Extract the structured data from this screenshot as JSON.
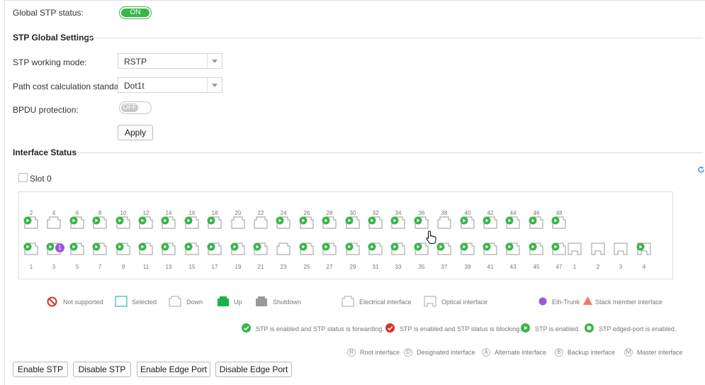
{
  "global": {
    "status_label": "Global STP status:",
    "status_toggle": "ON"
  },
  "settings": {
    "title": "STP Global Settings",
    "mode_label": "STP working mode:",
    "mode_value": "RSTP",
    "path_label": "Path cost calculation standard:",
    "path_value": "Dot1t",
    "bpdu_label": "BPDU protection:",
    "bpdu_toggle": "OFF",
    "apply": "Apply"
  },
  "interface": {
    "title": "Interface Status",
    "slot_label": "Slot 0",
    "top_ports": [
      {
        "n": "2",
        "state": "enabled"
      },
      {
        "n": "4",
        "state": "down"
      },
      {
        "n": "6",
        "state": "enabled"
      },
      {
        "n": "8",
        "state": "enabled"
      },
      {
        "n": "10",
        "state": "enabled"
      },
      {
        "n": "12",
        "state": "enabled"
      },
      {
        "n": "14",
        "state": "enabled"
      },
      {
        "n": "16",
        "state": "enabled"
      },
      {
        "n": "18",
        "state": "enabled"
      },
      {
        "n": "20",
        "state": "down"
      },
      {
        "n": "22",
        "state": "down"
      },
      {
        "n": "24",
        "state": "enabled"
      },
      {
        "n": "26",
        "state": "enabled"
      },
      {
        "n": "28",
        "state": "enabled"
      },
      {
        "n": "30",
        "state": "enabled"
      },
      {
        "n": "32",
        "state": "enabled"
      },
      {
        "n": "34",
        "state": "enabled"
      },
      {
        "n": "36",
        "state": "enabled"
      },
      {
        "n": "38",
        "state": "down"
      },
      {
        "n": "40",
        "state": "enabled"
      },
      {
        "n": "42",
        "state": "enabled"
      },
      {
        "n": "44",
        "state": "enabled"
      },
      {
        "n": "46",
        "state": "enabled"
      },
      {
        "n": "48",
        "state": "enabled"
      }
    ],
    "bottom_ports": [
      {
        "n": "1",
        "state": "enabled"
      },
      {
        "n": "3",
        "state": "trunk"
      },
      {
        "n": "5",
        "state": "enabled"
      },
      {
        "n": "7",
        "state": "enabled"
      },
      {
        "n": "9",
        "state": "enabled"
      },
      {
        "n": "11",
        "state": "enabled"
      },
      {
        "n": "13",
        "state": "enabled"
      },
      {
        "n": "15",
        "state": "enabled"
      },
      {
        "n": "17",
        "state": "enabled"
      },
      {
        "n": "19",
        "state": "enabled"
      },
      {
        "n": "21",
        "state": "enabled"
      },
      {
        "n": "23",
        "state": "down"
      },
      {
        "n": "25",
        "state": "enabled"
      },
      {
        "n": "27",
        "state": "enabled"
      },
      {
        "n": "29",
        "state": "enabled"
      },
      {
        "n": "31",
        "state": "enabled"
      },
      {
        "n": "33",
        "state": "enabled"
      },
      {
        "n": "35",
        "state": "enabled"
      },
      {
        "n": "37",
        "state": "enabled"
      },
      {
        "n": "39",
        "state": "enabled"
      },
      {
        "n": "41",
        "state": "enabled"
      },
      {
        "n": "43",
        "state": "enabled"
      },
      {
        "n": "45",
        "state": "enabled"
      },
      {
        "n": "47",
        "state": "enabled"
      }
    ],
    "optical_ports": [
      {
        "n": "1",
        "state": "optical"
      },
      {
        "n": "2",
        "state": "optical"
      },
      {
        "n": "3",
        "state": "optical"
      },
      {
        "n": "4",
        "state": "optical-enabled"
      }
    ],
    "trunk_badge": "1"
  },
  "legend": {
    "not_supported": "Not supported",
    "selected": "Selected",
    "down": "Down",
    "up": "Up",
    "shutdown": "Shutdown",
    "electrical": "Electrical interface",
    "optical": "Optical interface",
    "eth_trunk": "Eth-Trunk",
    "stack_member": "Stack member interface",
    "forwarding": "STP is enabled and STP status is forwarding.",
    "blocking": "STP is enabled and STP status is blocking.",
    "enabled": "STP is enabled.",
    "edged": "STP edged-port is enabled.",
    "roles": [
      {
        "letter": "R",
        "text": "Root interface"
      },
      {
        "letter": "D",
        "text": "Designated interface"
      },
      {
        "letter": "A",
        "text": "Alternate interface"
      },
      {
        "letter": "B",
        "text": "Backup interface"
      },
      {
        "letter": "M",
        "text": "Master interface"
      }
    ]
  },
  "actions": {
    "enable_stp": "Enable STP",
    "disable_stp": "Disable STP",
    "enable_edge": "Enable Edge Port",
    "disable_edge": "Disable Edge Port"
  },
  "colors": {
    "green": "#3ab54a",
    "red": "#d9322b",
    "purple": "#9b59d9",
    "salmon": "#f07a6a",
    "cyan": "#31b8d6"
  }
}
